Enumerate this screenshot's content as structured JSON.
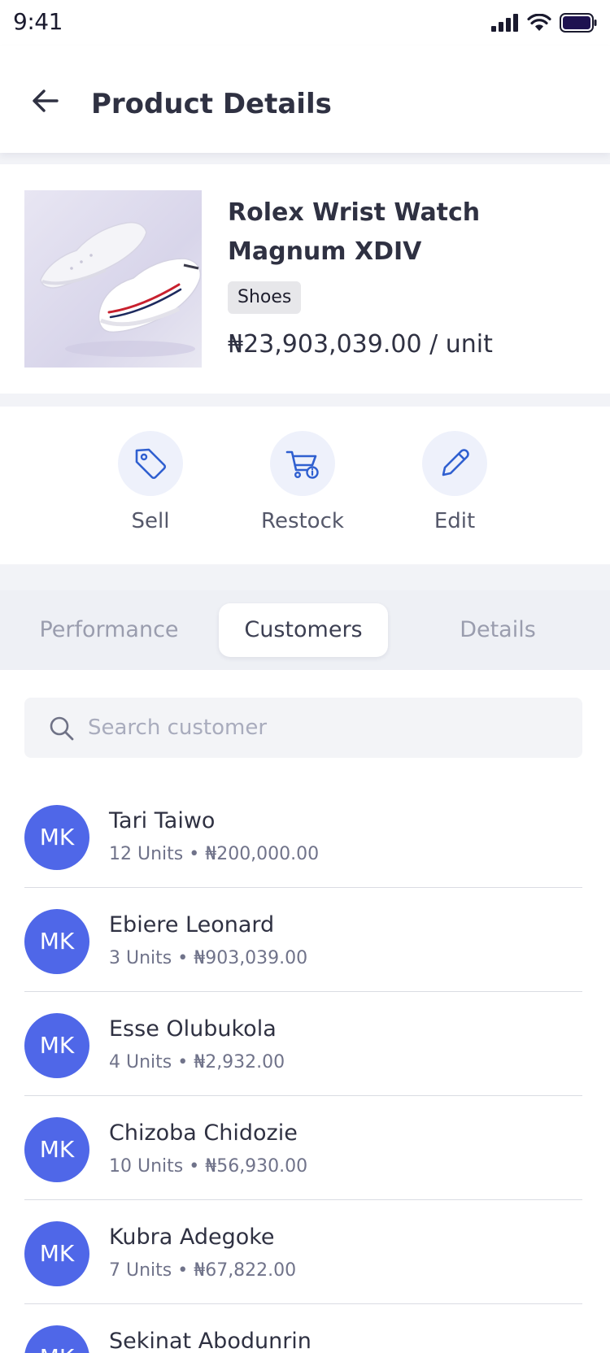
{
  "status_bar": {
    "time": "9:41"
  },
  "header": {
    "title": "Product Details"
  },
  "product": {
    "name": "Rolex Wrist Watch Magnum XDIV",
    "category": "Shoes",
    "price": "₦23,903,039.00 / unit"
  },
  "actions": [
    {
      "label": "Sell",
      "icon": "tag-icon"
    },
    {
      "label": "Restock",
      "icon": "cart-icon"
    },
    {
      "label": "Edit",
      "icon": "pencil-icon"
    }
  ],
  "tabs": [
    {
      "label": "Performance",
      "active": false
    },
    {
      "label": "Customers",
      "active": true
    },
    {
      "label": "Details",
      "active": false
    }
  ],
  "search": {
    "placeholder": "Search customer"
  },
  "customers": [
    {
      "initials": "MK",
      "name": "Tari Taiwo",
      "meta": "12 Units • ₦200,000.00"
    },
    {
      "initials": "MK",
      "name": "Ebiere Leonard",
      "meta": "3 Units • ₦903,039.00"
    },
    {
      "initials": "MK",
      "name": "Esse Olubukola",
      "meta": "4 Units • ₦2,932.00"
    },
    {
      "initials": "MK",
      "name": "Chizoba Chidozie",
      "meta": "10 Units • ₦56,930.00"
    },
    {
      "initials": "MK",
      "name": "Kubra Adegoke",
      "meta": "7 Units • ₦67,822.00"
    },
    {
      "initials": "MK",
      "name": "Sekinat Abodunrin",
      "meta": ""
    }
  ],
  "colors": {
    "accent": "#4f67e8",
    "icon_blue": "#2f5fd0",
    "action_bg": "#eef1fb",
    "divider": "#dadce3"
  }
}
